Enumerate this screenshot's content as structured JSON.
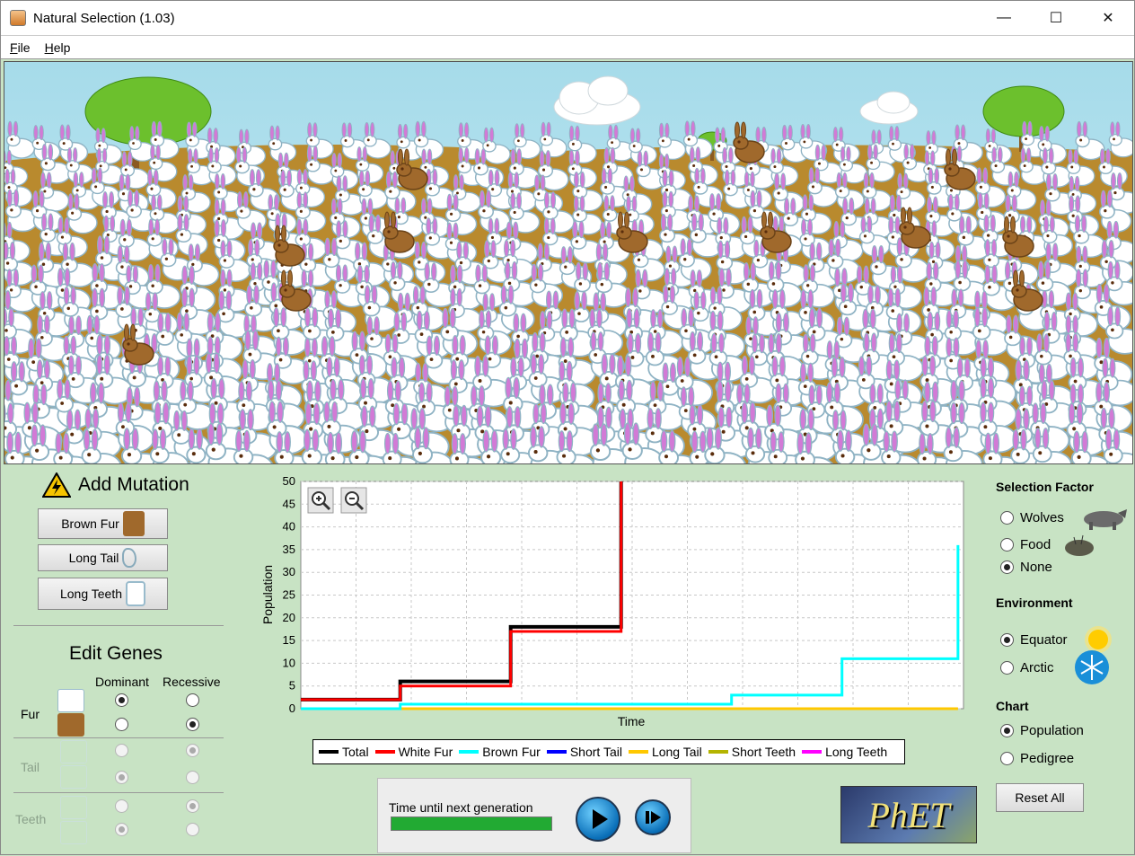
{
  "window": {
    "title": "Natural Selection (1.03)",
    "minimize_glyph": "—",
    "maximize_glyph": "☐",
    "close_glyph": "✕"
  },
  "menu": {
    "file": "File",
    "help": "Help"
  },
  "mutation": {
    "title": "Add Mutation",
    "brown_fur": "Brown Fur",
    "long_tail": "Long Tail",
    "long_teeth": "Long Teeth"
  },
  "genes": {
    "title": "Edit Genes",
    "dominant": "Dominant",
    "recessive": "Recessive",
    "fur": "Fur",
    "tail": "Tail",
    "teeth": "Teeth",
    "fur_dominant": "White Fur",
    "tail_enabled": false,
    "teeth_enabled": false
  },
  "chart_data": {
    "type": "line",
    "xlabel": "Time",
    "ylabel": "Population",
    "ylim": [
      0,
      50
    ],
    "yticks": [
      0,
      5,
      10,
      15,
      20,
      25,
      30,
      35,
      40,
      45,
      50
    ],
    "grid": true,
    "legend_position": "bottom",
    "x_range": [
      0,
      12
    ],
    "series": [
      {
        "name": "Total",
        "color": "#000000",
        "points": [
          [
            0,
            2
          ],
          [
            1.8,
            2
          ],
          [
            1.8,
            6
          ],
          [
            3.8,
            6
          ],
          [
            3.8,
            18
          ],
          [
            5.8,
            18
          ],
          [
            5.8,
            50
          ]
        ]
      },
      {
        "name": "White Fur",
        "color": "#ff0000",
        "points": [
          [
            0,
            2
          ],
          [
            1.8,
            2
          ],
          [
            1.8,
            5
          ],
          [
            3.8,
            5
          ],
          [
            3.8,
            17
          ],
          [
            5.8,
            17
          ],
          [
            5.8,
            50
          ]
        ]
      },
      {
        "name": "Brown Fur",
        "color": "#00ffff",
        "points": [
          [
            0,
            0
          ],
          [
            1.8,
            0
          ],
          [
            1.8,
            1
          ],
          [
            7.8,
            1
          ],
          [
            7.8,
            3
          ],
          [
            9.8,
            3
          ],
          [
            9.8,
            11
          ],
          [
            11.9,
            11
          ],
          [
            11.9,
            36
          ]
        ]
      },
      {
        "name": "Short Tail",
        "color": "#0000ff",
        "points": []
      },
      {
        "name": "Long Tail",
        "color": "#ffc800",
        "points": [
          [
            0,
            0
          ],
          [
            11.9,
            0
          ]
        ]
      },
      {
        "name": "Short Teeth",
        "color": "#b4b400",
        "points": []
      },
      {
        "name": "Long Teeth",
        "color": "#ff00ff",
        "points": []
      }
    ]
  },
  "timer": {
    "label": "Time until next generation",
    "progress": 1.0
  },
  "selection": {
    "title": "Selection Factor",
    "wolves": "Wolves",
    "food": "Food",
    "none": "None",
    "selected": "None"
  },
  "environment": {
    "title": "Environment",
    "equator": "Equator",
    "arctic": "Arctic",
    "selected": "Equator"
  },
  "chart_mode": {
    "title": "Chart",
    "population": "Population",
    "pedigree": "Pedigree",
    "selected": "Population"
  },
  "reset": "Reset All",
  "logo": "PhET",
  "colors": {
    "panel": "#c8e3c4",
    "sky": "#a9dcea",
    "ground": "#b98a2e",
    "bunny_white": "#ffffff",
    "bunny_brown": "#a0692c"
  }
}
